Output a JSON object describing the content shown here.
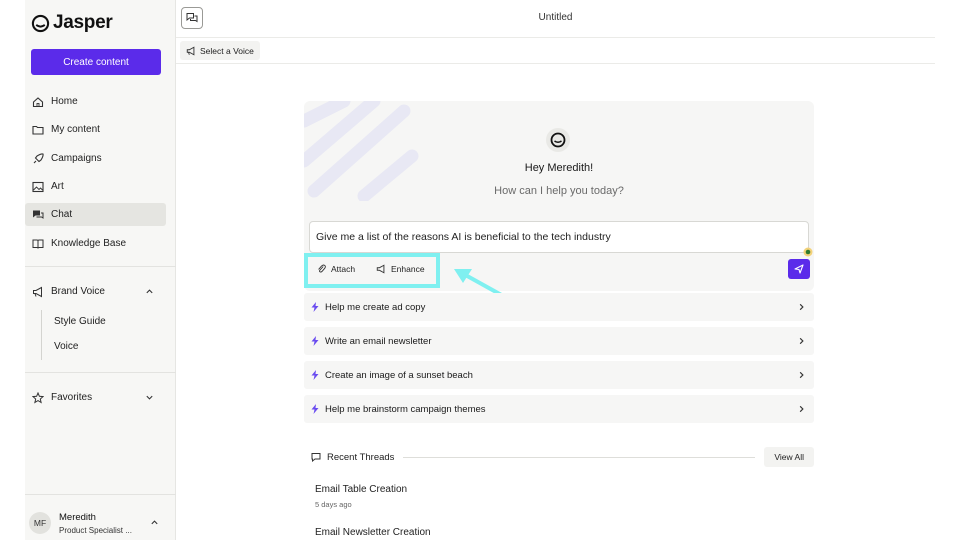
{
  "app": {
    "name": "Jasper"
  },
  "sidebar": {
    "create_label": "Create content",
    "items": [
      {
        "label": "Home",
        "icon": "home-icon"
      },
      {
        "label": "My content",
        "icon": "folder-icon"
      },
      {
        "label": "Campaigns",
        "icon": "rocket-icon"
      },
      {
        "label": "Art",
        "icon": "image-icon"
      },
      {
        "label": "Chat",
        "icon": "chat-icon",
        "active": true
      },
      {
        "label": "Knowledge Base",
        "icon": "book-icon"
      }
    ],
    "brand_voice": {
      "label": "Brand Voice",
      "icon": "megaphone-icon",
      "subitems": [
        "Style Guide",
        "Voice"
      ]
    },
    "favorites": {
      "label": "Favorites",
      "icon": "star-icon"
    },
    "user": {
      "initials": "MF",
      "name": "Meredith",
      "role": "Product Specialist ..."
    }
  },
  "header": {
    "title": "Untitled",
    "voice_label": "Select a Voice"
  },
  "chat": {
    "greeting": "Hey Meredith!",
    "subgreeting": "How can I help you today?",
    "input_value": "Give me a list of the reasons AI is beneficial to the tech industry",
    "attach_label": "Attach",
    "enhance_label": "Enhance",
    "suggestions": [
      "Help me create ad copy",
      "Write an email newsletter",
      "Create an image of a sunset beach",
      "Help me brainstorm campaign themes"
    ],
    "recent_label": "Recent Threads",
    "view_all_label": "View All",
    "threads": [
      {
        "title": "Email Table Creation",
        "time": "5 days ago"
      },
      {
        "title": "Email Newsletter Creation",
        "time": ""
      }
    ]
  },
  "colors": {
    "accent": "#5b2bea",
    "highlight": "#7ff0f0"
  }
}
